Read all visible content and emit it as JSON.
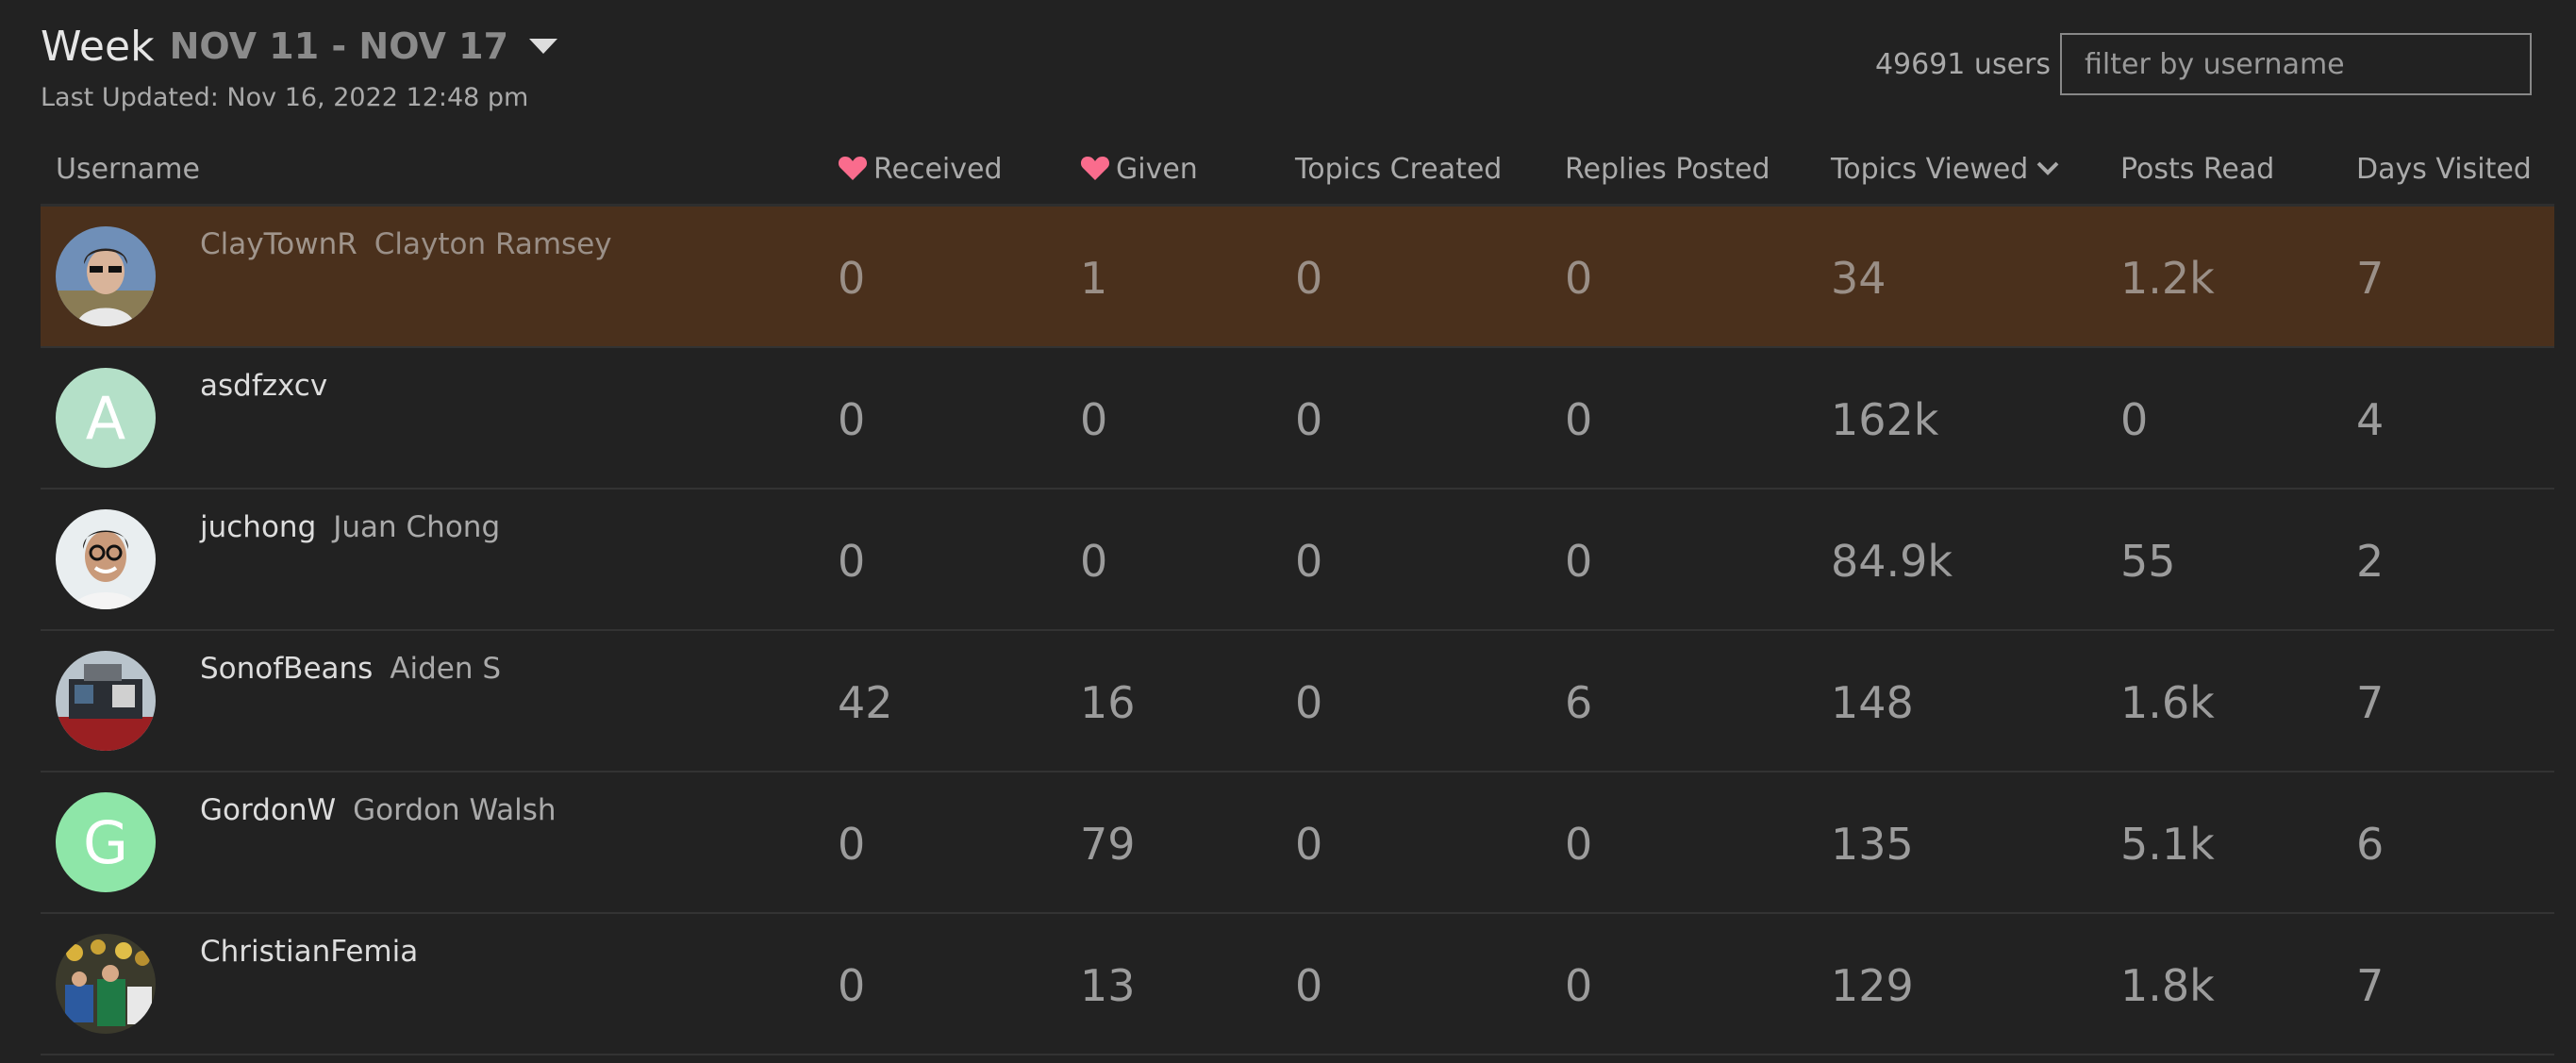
{
  "header": {
    "period": "Week",
    "range": "NOV 11 - NOV 17",
    "last_updated": "Last Updated: Nov 16, 2022 12:48 pm",
    "users_count": "49691 users",
    "filter_placeholder": "filter by username"
  },
  "columns": {
    "username": "Username",
    "received": "Received",
    "given": "Given",
    "topics_created": "Topics Created",
    "replies_posted": "Replies Posted",
    "topics_viewed": "Topics Viewed",
    "posts_read": "Posts Read",
    "days_visited": "Days Visited"
  },
  "colors": {
    "background": "#222222",
    "highlight_row": "#4a301c",
    "heart": "#fa6c8d",
    "avatar_a": "#b4e0c8",
    "avatar_g": "#8ee6a8"
  },
  "rows": [
    {
      "username": "ClayTownR",
      "name": "Clayton Ramsey",
      "avatar": "photo-avatar",
      "received": "0",
      "given": "1",
      "topics_created": "0",
      "replies_posted": "0",
      "topics_viewed": "34",
      "posts_read": "1.2k",
      "days_visited": "7"
    },
    {
      "username": "asdfzxcv",
      "name": "",
      "avatar_letter": "A",
      "received": "0",
      "given": "0",
      "topics_created": "0",
      "replies_posted": "0",
      "topics_viewed": "162k",
      "posts_read": "0",
      "days_visited": "4"
    },
    {
      "username": "juchong",
      "name": "Juan Chong",
      "avatar": "photo-avatar",
      "received": "0",
      "given": "0",
      "topics_created": "0",
      "replies_posted": "0",
      "topics_viewed": "84.9k",
      "posts_read": "55",
      "days_visited": "2"
    },
    {
      "username": "SonofBeans",
      "name": "Aiden S",
      "avatar": "photo-avatar",
      "received": "42",
      "given": "16",
      "topics_created": "0",
      "replies_posted": "6",
      "topics_viewed": "148",
      "posts_read": "1.6k",
      "days_visited": "7"
    },
    {
      "username": "GordonW",
      "name": "Gordon Walsh",
      "avatar_letter": "G",
      "received": "0",
      "given": "79",
      "topics_created": "0",
      "replies_posted": "0",
      "topics_viewed": "135",
      "posts_read": "5.1k",
      "days_visited": "6"
    },
    {
      "username": "ChristianFemia",
      "name": "",
      "avatar": "photo-avatar",
      "received": "0",
      "given": "13",
      "topics_created": "0",
      "replies_posted": "0",
      "topics_viewed": "129",
      "posts_read": "1.8k",
      "days_visited": "7"
    }
  ]
}
